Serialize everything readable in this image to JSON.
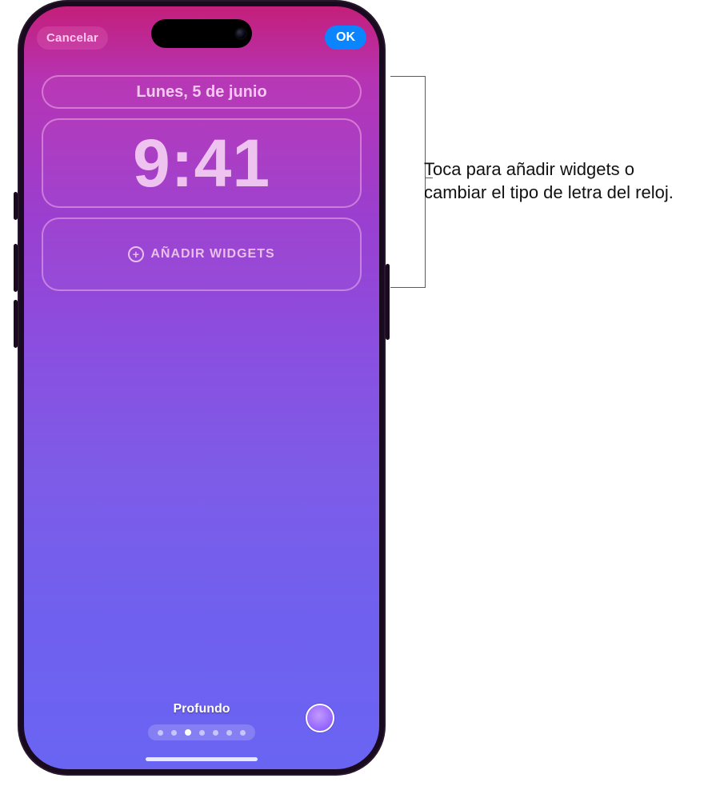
{
  "topbar": {
    "cancel_label": "Cancelar",
    "ok_label": "OK"
  },
  "lockscreen": {
    "date": "Lunes, 5 de junio",
    "time": "9:41",
    "add_widgets_label": "AÑADIR WIDGETS",
    "style_name": "Profundo",
    "pager": {
      "count": 7,
      "active_index": 2
    },
    "swatch_color": "#9a6bff"
  },
  "callout": {
    "text": "Toca para añadir widgets o cambiar el tipo de letra del reloj."
  }
}
